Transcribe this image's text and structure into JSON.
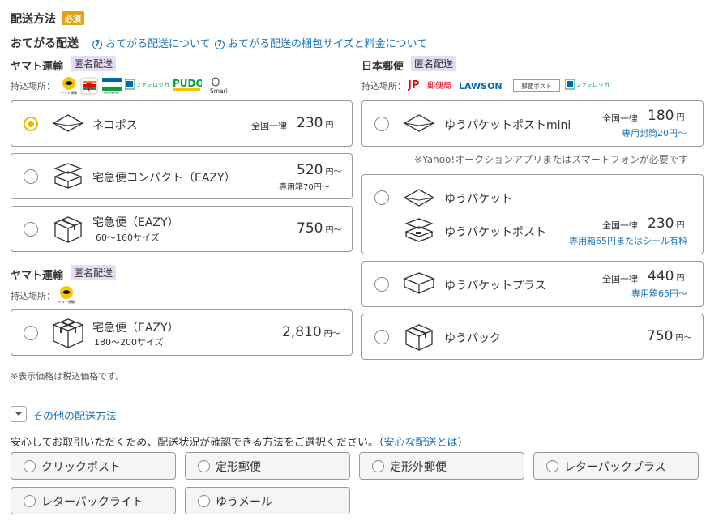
{
  "header": {
    "title": "配送方法",
    "required_badge": "必須",
    "subtitle": "おてがる配送",
    "link1": "おてがる配送について",
    "link2": "おてがる配送の梱包サイズと料金について"
  },
  "yamato1": {
    "carrier": "ヤマト運輸",
    "badge": "匿名配送",
    "pickup_label": "持込場所：",
    "logos": [
      "ヤマト運輸",
      "セブンイレブン",
      "ファミリーマート",
      "ファミロッカー",
      "PUDO",
      "Smari"
    ]
  },
  "japanpost": {
    "carrier": "日本郵便",
    "badge": "匿名配送",
    "pickup_label": "持込場所：",
    "logos": [
      "郵便局",
      "LAWSON",
      "郵便ポスト",
      "ファミロッカー"
    ]
  },
  "options_left": [
    {
      "name": "ネコポス",
      "price_label": "全国一律",
      "price": "230",
      "unit": "円",
      "note": ""
    },
    {
      "name": "宅急便コンパクト（EAZY）",
      "price_label": "",
      "price": "520",
      "unit": "円〜",
      "note": "専用箱70円〜"
    },
    {
      "name": "宅急便（EAZY）",
      "sub": "60〜160サイズ",
      "price_label": "",
      "price": "750",
      "unit": "円〜",
      "note": ""
    }
  ],
  "yamato2": {
    "carrier": "ヤマト運輸",
    "badge": "匿名配送",
    "pickup_label": "持込場所：",
    "logos": [
      "ヤマト運輸"
    ],
    "option": {
      "name": "宅急便（EAZY）",
      "sub": "180〜200サイズ",
      "price": "2,810",
      "unit": "円〜"
    }
  },
  "options_right": [
    {
      "name": "ゆうパケットポストmini",
      "price_label": "全国一律",
      "price": "180",
      "unit": "円",
      "note": "専用封筒20円〜"
    },
    {
      "name": "ゆうパケット",
      "name2": "ゆうパケットポスト",
      "price_label": "全国一律",
      "price": "230",
      "unit": "円",
      "note": "専用箱65円またはシール有料"
    },
    {
      "name": "ゆうパケットプラス",
      "price_label": "全国一律",
      "price": "440",
      "unit": "円",
      "note": "専用箱65円〜"
    },
    {
      "name": "ゆうパック",
      "price_label": "",
      "price": "750",
      "unit": "円〜",
      "note": ""
    }
  ],
  "yahoo_note": "※Yahoo!オークションアプリまたはスマートフォンが必要です",
  "tax_note": "※表示価格は税込価格です。",
  "other": {
    "toggle": "その他の配送方法",
    "desc_prefix": "安心してお取引いただくため、配送状況が確認できる方法をご選択ください。（",
    "desc_link": "安心な配送とは",
    "desc_suffix": "）",
    "buttons": [
      "クリックポスト",
      "定形郵便",
      "定形外郵便",
      "レターパックプラス",
      "レターパックライト",
      "ゆうメール"
    ]
  },
  "colors": {
    "accent": "#f4b400",
    "link": "#1a73b8",
    "badge_bg": "#e6dcf4",
    "required": "#e0a417"
  }
}
